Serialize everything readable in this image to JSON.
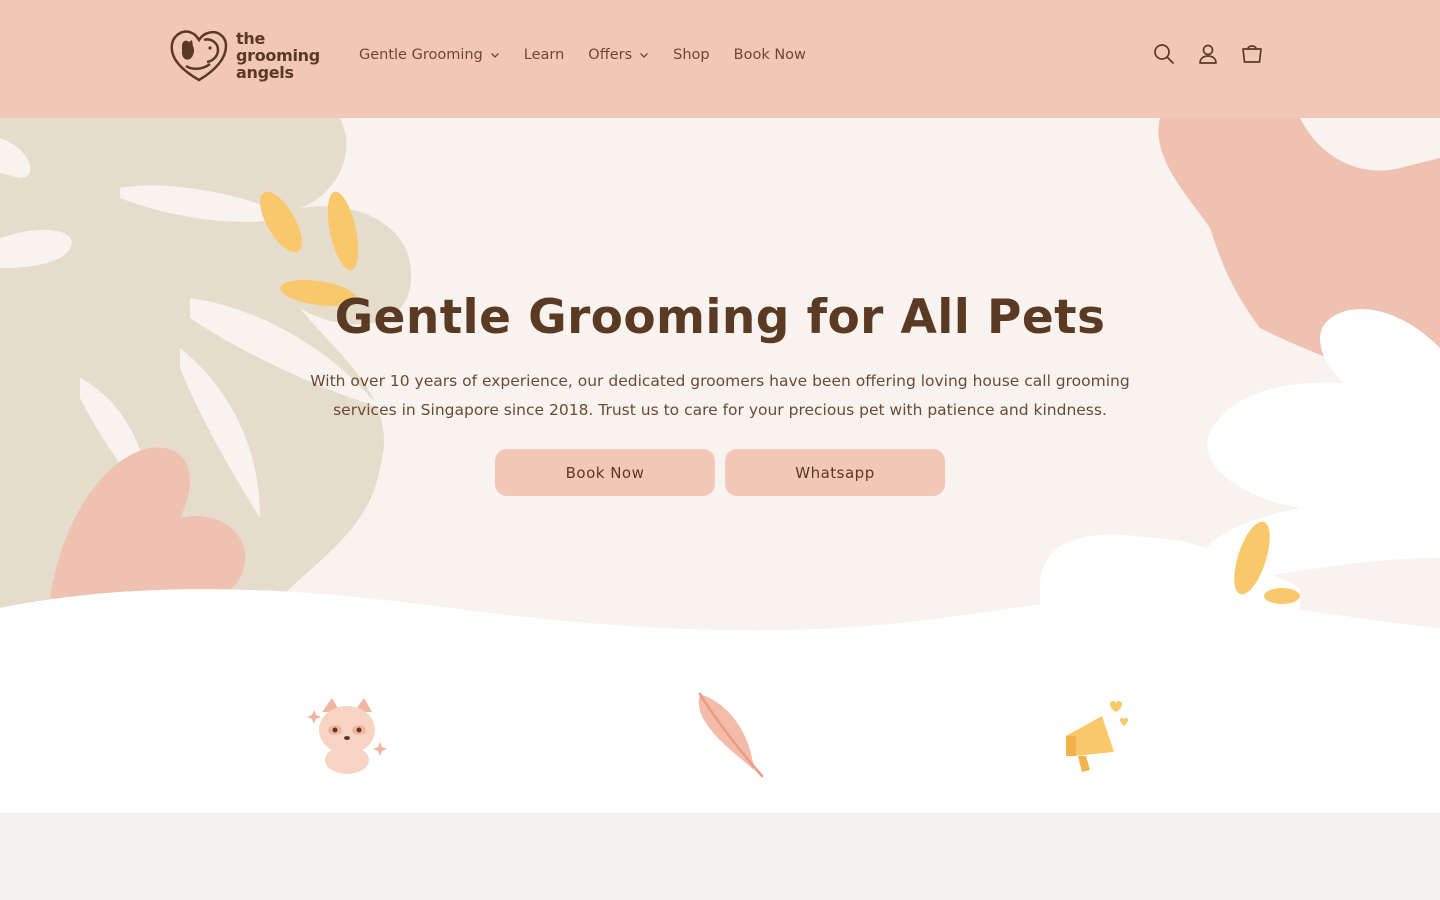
{
  "brand": {
    "line1": "the",
    "line2": "grooming",
    "line3": "angels"
  },
  "nav": {
    "items": [
      {
        "label": "Gentle Grooming",
        "has_dropdown": true
      },
      {
        "label": "Learn",
        "has_dropdown": false
      },
      {
        "label": "Offers",
        "has_dropdown": true
      },
      {
        "label": "Shop",
        "has_dropdown": false
      },
      {
        "label": "Book Now",
        "has_dropdown": false
      }
    ]
  },
  "header_icons": [
    "search-icon",
    "account-icon",
    "cart-icon"
  ],
  "hero": {
    "title": "Gentle Grooming for All Pets",
    "description": "With over 10 years of experience, our dedicated groomers have been offering loving house call grooming services in Singapore since 2018. Trust us to care for your precious pet with patience and kindness.",
    "primary_button": "Book Now",
    "secondary_button": "Whatsapp"
  },
  "features": {
    "icons": [
      "sparkling-cat-icon",
      "feather-icon",
      "megaphone-hearts-icon"
    ]
  },
  "colors": {
    "header_bg": "#f2c7b7",
    "hero_bg": "#f8f3ee",
    "text_brown": "#5a3a22",
    "leaf_beige": "#e6dccb",
    "leaf_pink": "#efc1b1",
    "leaf_yellow": "#f9c86a",
    "button_bg": "#f2c7b7"
  }
}
